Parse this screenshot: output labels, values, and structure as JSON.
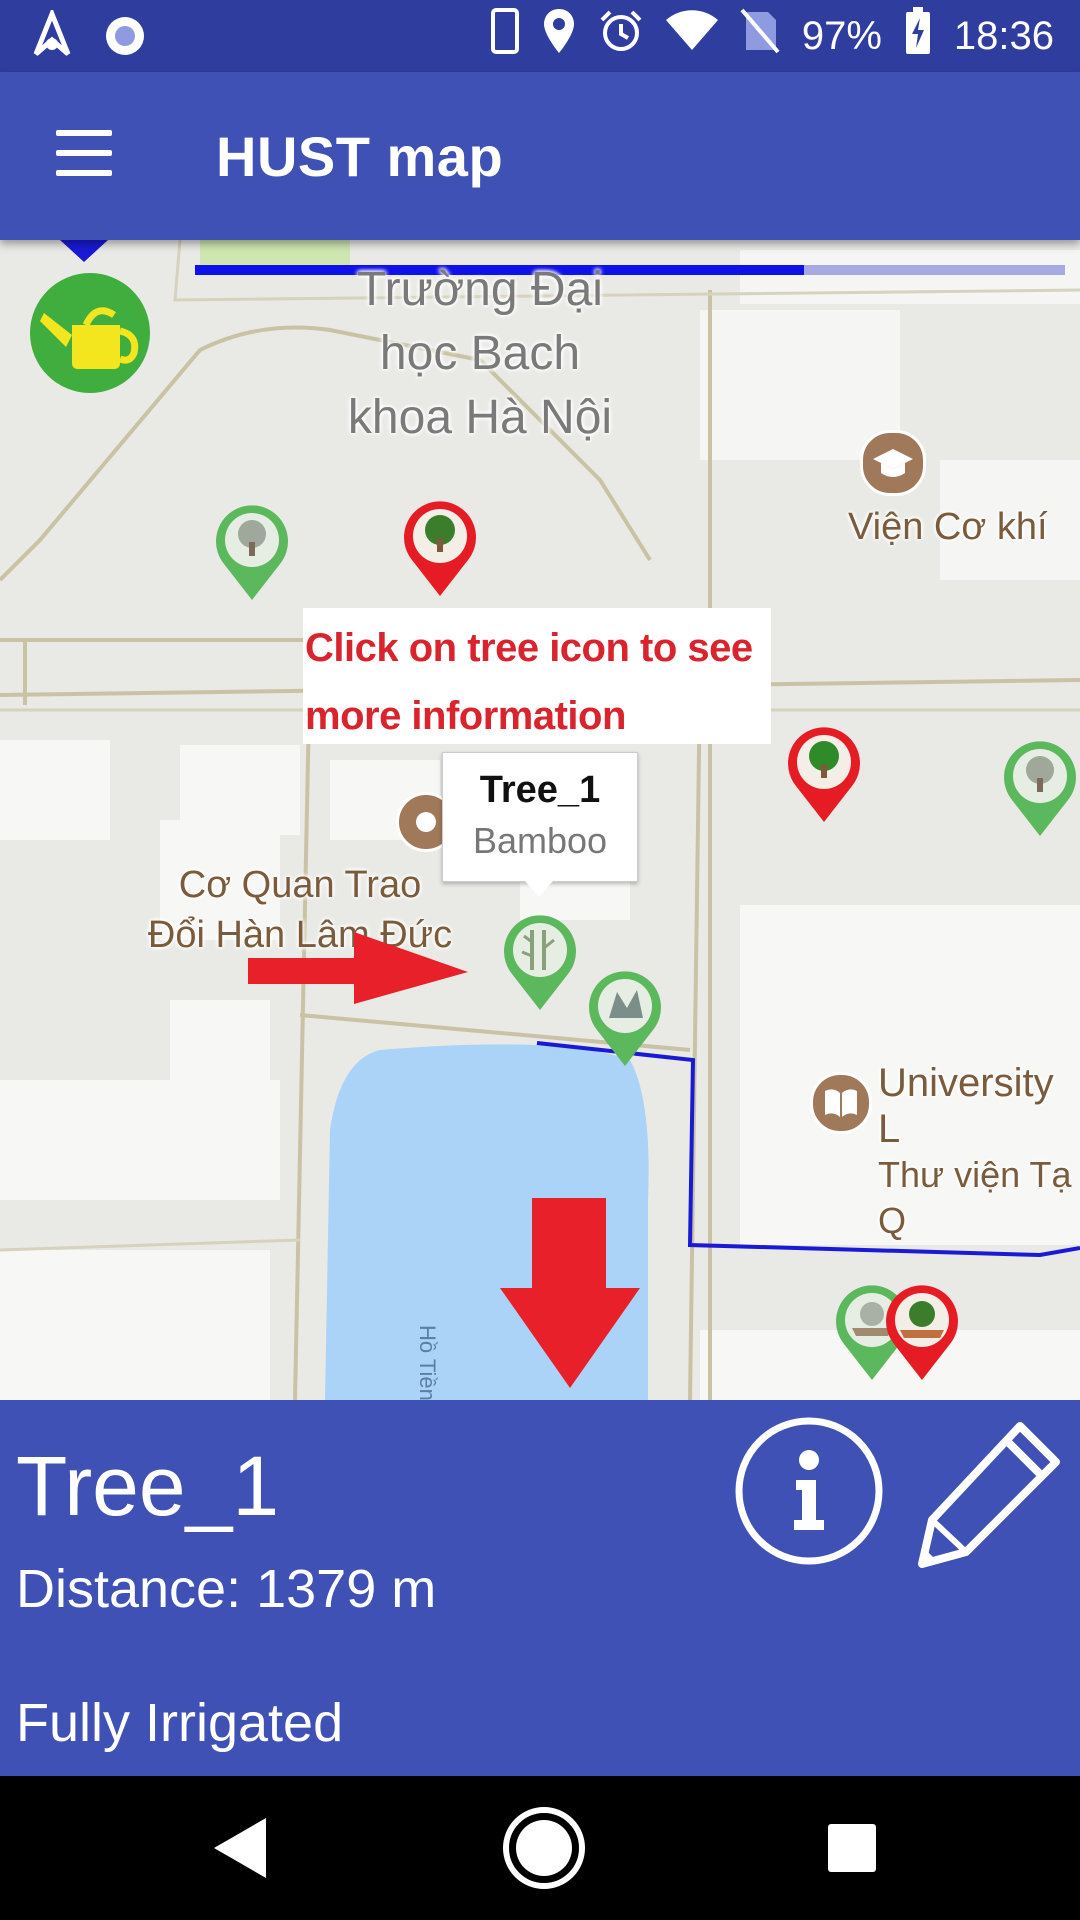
{
  "status_bar": {
    "battery": "97%",
    "time": "18:36",
    "icons": [
      "notification-app-icon",
      "notification-circle-icon",
      "phone-icon",
      "location-icon",
      "alarm-icon",
      "wifi-icon",
      "no-sim-icon",
      "battery-charging-icon"
    ]
  },
  "app_bar": {
    "title": "HUST map",
    "menu_icon": "hamburger-menu-icon"
  },
  "map": {
    "labels": {
      "university": [
        "Trường Đại",
        "học Bach",
        "khoa Hà Nội"
      ],
      "vien_co_khi": "Viện Cơ khí",
      "co_quan": [
        "Cơ Quan Trao",
        "Đổi Hàn Lâm Đức"
      ],
      "library": [
        "University L",
        "Thư viện Tạ Q"
      ],
      "lake": "Hồ Tiền"
    },
    "note": [
      "Click on tree icon to see",
      "more information"
    ],
    "popup": {
      "title": "Tree_1",
      "subtitle": "Bamboo"
    },
    "progress": 0.7,
    "colors": {
      "tree_ok": "#5cb85c",
      "tree_alert": "#e51c23",
      "route": "#1a1ad6",
      "annotation_arrow": "#e8202a",
      "water": "#aad3f7"
    }
  },
  "details": {
    "tree_name": "Tree_1",
    "distance": "Distance: 1379 m",
    "irrigation_status": "Fully Irrigated",
    "info_icon": "info-icon",
    "edit_icon": "pencil-icon"
  },
  "nav_bar": {
    "icons": [
      "back-icon",
      "home-icon",
      "recents-icon"
    ]
  }
}
